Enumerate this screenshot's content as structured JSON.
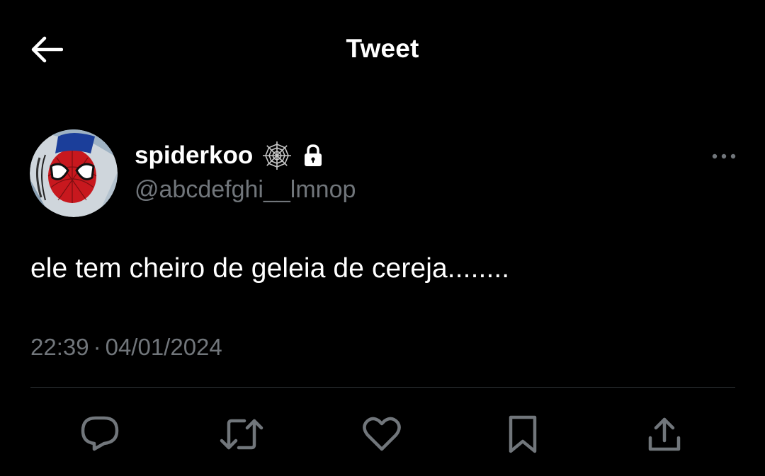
{
  "header": {
    "title": "Tweet",
    "back_icon": "arrow-left-icon"
  },
  "author": {
    "display_name": "spiderkoo",
    "handle": "@abcdefghi__lmnop",
    "badges": [
      "spider-web-icon",
      "lock-icon"
    ],
    "avatar": "spider-man-avatar"
  },
  "tweet": {
    "text": "ele tem cheiro de geleia de cereja........",
    "time": "22:39",
    "separator": "·",
    "date": "04/01/2024"
  },
  "actions": [
    "reply-icon",
    "retweet-icon",
    "like-icon",
    "bookmark-icon",
    "share-icon"
  ],
  "colors": {
    "background": "#000000",
    "text_primary": "#ffffff",
    "text_secondary": "#71767b",
    "divider": "#2f3336"
  }
}
